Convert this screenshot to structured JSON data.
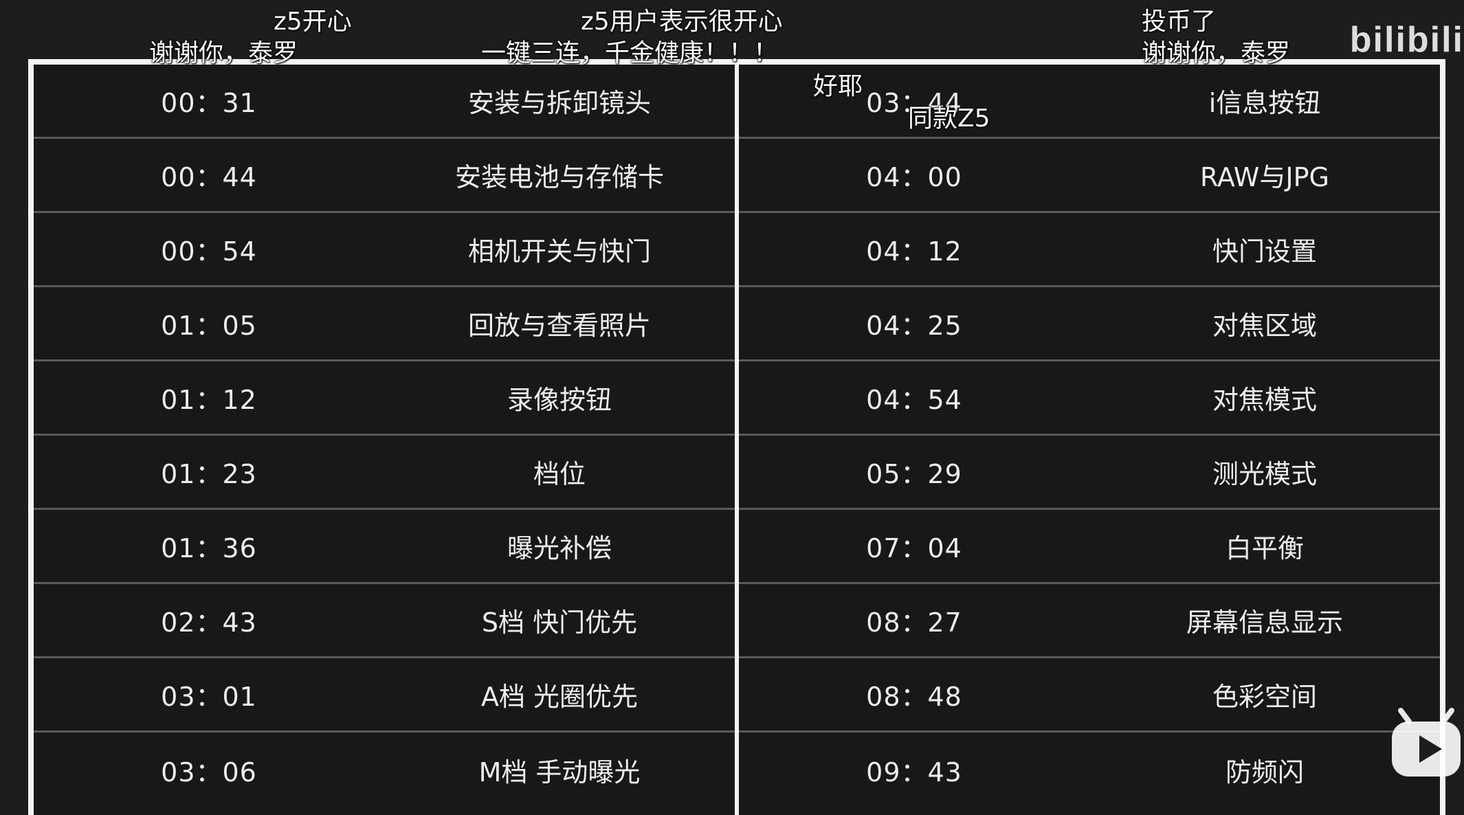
{
  "table": {
    "left": [
      {
        "time": "00：31",
        "title": "安装与拆卸镜头"
      },
      {
        "time": "00：44",
        "title": "安装电池与存储卡"
      },
      {
        "time": "00：54",
        "title": "相机开关与快门"
      },
      {
        "time": "01：05",
        "title": "回放与查看照片"
      },
      {
        "time": "01：12",
        "title": "录像按钮"
      },
      {
        "time": "01：23",
        "title": "档位"
      },
      {
        "time": "01：36",
        "title": "曝光补偿"
      },
      {
        "time": "02：43",
        "title": "S档 快门优先"
      },
      {
        "time": "03：01",
        "title": "A档 光圈优先"
      },
      {
        "time": "03：06",
        "title": "M档 手动曝光"
      }
    ],
    "right": [
      {
        "time": "03：44",
        "title": "i信息按钮"
      },
      {
        "time": "04：00",
        "title": "RAW与JPG"
      },
      {
        "time": "04：12",
        "title": "快门设置"
      },
      {
        "time": "04：25",
        "title": "对焦区域"
      },
      {
        "time": "04：54",
        "title": "对焦模式"
      },
      {
        "time": "05：29",
        "title": "测光模式"
      },
      {
        "time": "07：04",
        "title": "白平衡"
      },
      {
        "time": "08：27",
        "title": "屏幕信息显示"
      },
      {
        "time": "08：48",
        "title": "色彩空间"
      },
      {
        "time": "09：43",
        "title": "防频闪"
      }
    ]
  },
  "danmaku": {
    "d1": "z5开心",
    "d2": "谢谢你，泰罗",
    "d3": "z5用户表示很开心",
    "d4": "一键三连，千金健康！！！",
    "d5": "好耶",
    "d6": "同款Z5",
    "d7": "投币了",
    "d8": "谢谢你，泰罗"
  },
  "watermark": "bilibili"
}
